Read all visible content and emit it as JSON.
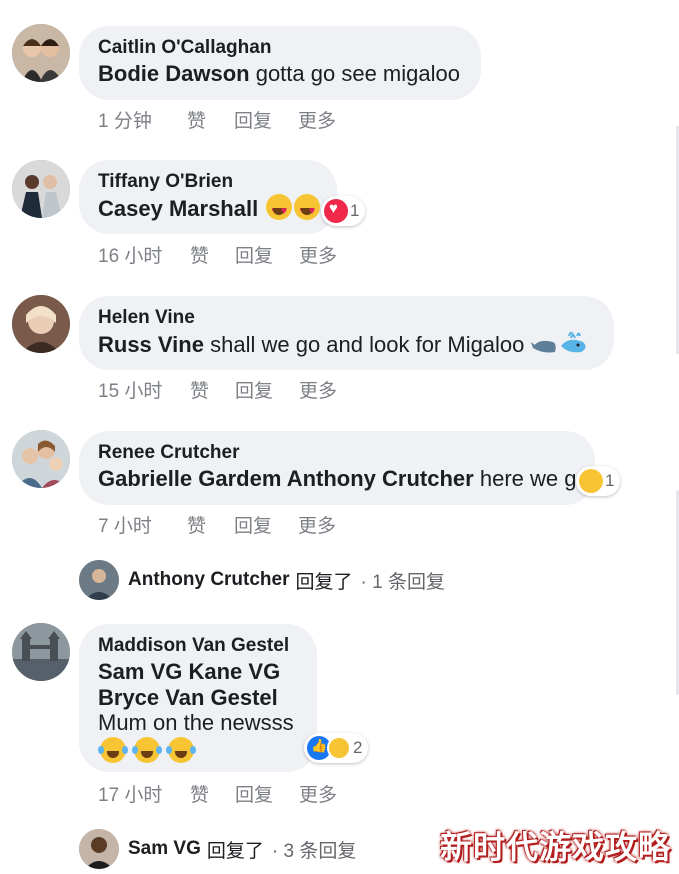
{
  "comments": [
    {
      "author": "Caitlin O'Callaghan",
      "tags": "Bodie Dawson",
      "text": "gotta go see migaloo",
      "time": "1 分钟",
      "like": "赞",
      "reply": "回复",
      "more": "更多"
    },
    {
      "author": "Tiffany O'Brien",
      "tags": "Casey Marshall",
      "text": "",
      "emojis": [
        "heart-eyes-emoji",
        "heart-eyes-emoji"
      ],
      "reactions": {
        "types": [
          "love"
        ],
        "count": "1"
      },
      "time": "16 小时",
      "like": "赞",
      "reply": "回复",
      "more": "更多"
    },
    {
      "author": "Helen Vine",
      "tags": "Russ Vine",
      "text": "shall we go and look for Migaloo",
      "emojis": [
        "whale-emoji",
        "spouting-whale-emoji"
      ],
      "time": "15 小时",
      "like": "赞",
      "reply": "回复",
      "more": "更多"
    },
    {
      "author": "Renee Crutcher",
      "tags": "Gabrielle Gardem Anthony Crutcher",
      "text": "here we go",
      "reactions": {
        "types": [
          "haha"
        ],
        "count": "1"
      },
      "time": "7 小时",
      "like": "赞",
      "reply": "回复",
      "more": "更多",
      "replies": {
        "name": "Anthony Crutcher",
        "verb": "回复了",
        "count": "· 1 条回复"
      }
    },
    {
      "author": "Maddison Van Gestel",
      "tags_line1": "Sam VG Kane VG",
      "tags_line2": "Bryce Van Gestel",
      "text": "Mum on the newsss",
      "emojis": [
        "tears-of-joy-emoji",
        "tears-of-joy-emoji",
        "tears-of-joy-emoji"
      ],
      "reactions": {
        "types": [
          "like",
          "haha"
        ],
        "count": "2"
      },
      "time": "17 小时",
      "like": "赞",
      "reply": "回复",
      "more": "更多",
      "replies": {
        "name": "Sam VG",
        "verb": "回复了",
        "count": "· 3 条回复"
      }
    }
  ],
  "watermark": "新时代游戏攻略",
  "colors": {
    "bubble": "#eff1f4",
    "meta": "#7d8086",
    "love": "#f0284a",
    "like": "#1877f2",
    "emoji": "#f7c533"
  }
}
